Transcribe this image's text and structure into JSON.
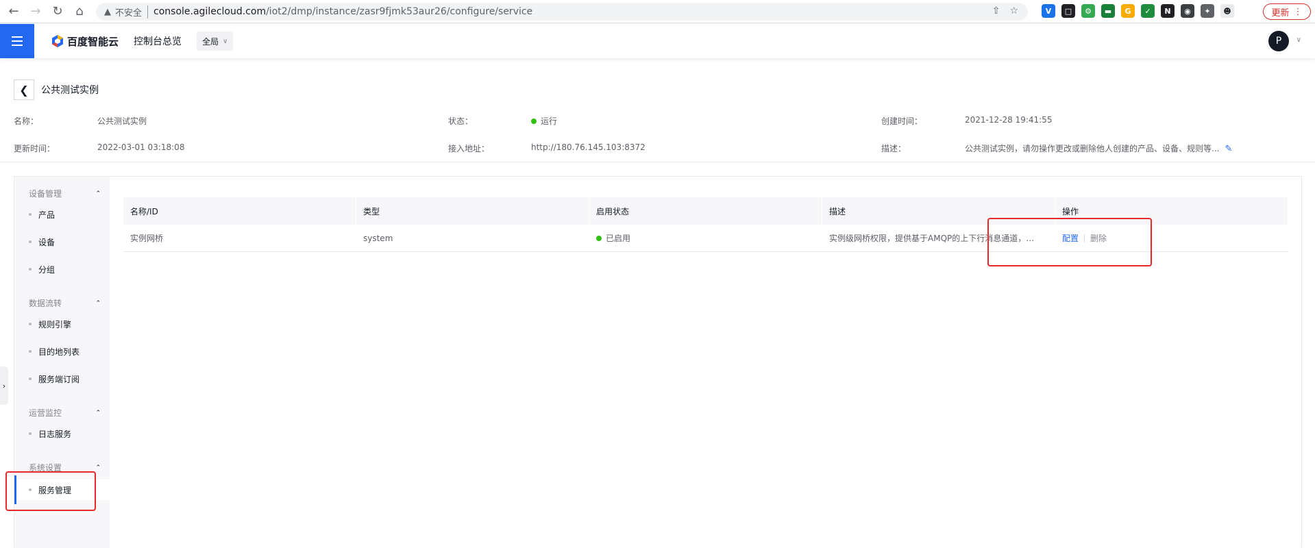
{
  "browser": {
    "insecure_label": "不安全",
    "url_host": "console.agilecloud.com",
    "url_path": "/iot2/dmp/instance/zasr9fjmk53aur26/configure/service",
    "update_label": "更新"
  },
  "header": {
    "brand": "百度智能云",
    "console_home": "控制台总览",
    "region": "全局",
    "avatar_letter": "P"
  },
  "instance": {
    "title": "公共测试实例",
    "fields": {
      "name_label": "名称：",
      "name_value": "公共测试实例",
      "status_label": "状态：",
      "status_value": "运行",
      "created_label": "创建时间：",
      "created_value": "2021-12-28 19:41:55",
      "updated_label": "更新时间：",
      "updated_value": "2022-03-01 03:18:08",
      "endpoint_label": "接入地址：",
      "endpoint_value": "http://180.76.145.103:8372",
      "desc_label": "描述：",
      "desc_value": "公共测试实例，请勿操作更改或删除他人创建的产品、设备、规则等..."
    },
    "status_color": "#30bf13"
  },
  "sidebar": {
    "groups": [
      {
        "label": "设备管理",
        "items": [
          "产品",
          "设备",
          "分组"
        ]
      },
      {
        "label": "数据流转",
        "items": [
          "规则引擎",
          "目的地列表",
          "服务端订阅"
        ]
      },
      {
        "label": "运营监控",
        "items": [
          "日志服务"
        ]
      },
      {
        "label": "系统设置",
        "items": [
          "服务管理"
        ]
      }
    ],
    "active_item": "服务管理"
  },
  "table": {
    "columns": [
      "名称/ID",
      "类型",
      "启用状态",
      "描述",
      "操作"
    ],
    "rows": [
      {
        "name": "实例网桥",
        "type": "system",
        "status": "已启用",
        "description": "实例级网桥权限，提供基于AMQP的上下行消息通道，可...",
        "action_config": "配置",
        "action_delete": "删除"
      }
    ]
  },
  "colors": {
    "accent": "#2468f2",
    "annotation": "#e8282b"
  }
}
